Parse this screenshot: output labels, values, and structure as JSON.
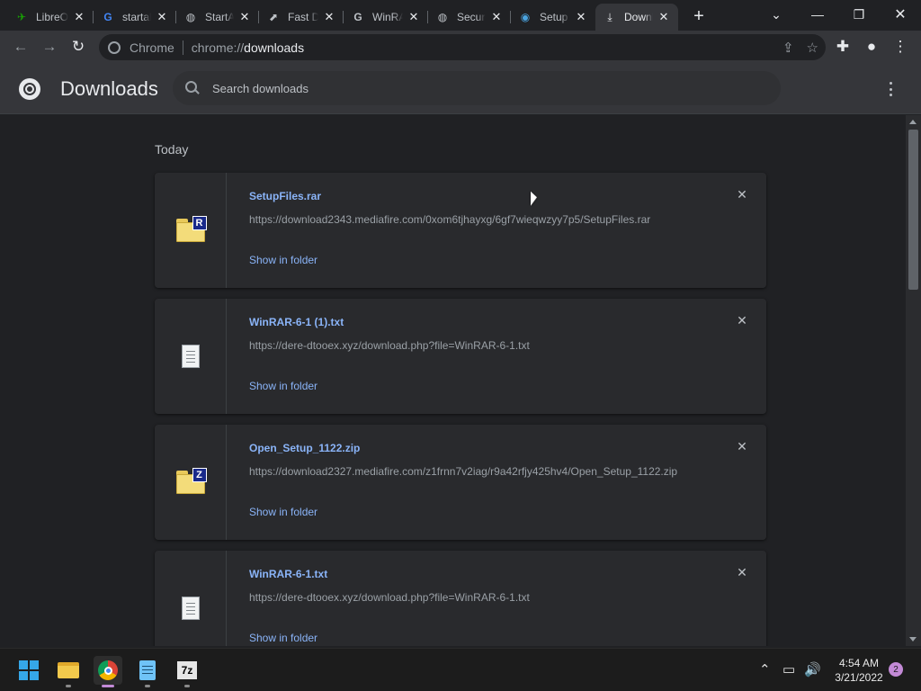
{
  "tabs": [
    {
      "title": "LibreOffice",
      "favicon": "libreoffice-icon",
      "glyph": "✈",
      "color": "#18a303"
    },
    {
      "title": "startallback",
      "favicon": "google-icon",
      "glyph": "G",
      "color": "#4285f4"
    },
    {
      "title": "StartAllBack",
      "favicon": "globe-icon",
      "glyph": "◍",
      "color": "#bdc1c6"
    },
    {
      "title": "Fast Download",
      "favicon": "fast-download-icon",
      "glyph": "⬈",
      "color": "#e8eaed"
    },
    {
      "title": "WinRAR",
      "favicon": "winrar-icon",
      "glyph": "G",
      "color": "#e8eaed"
    },
    {
      "title": "Security",
      "favicon": "globe-icon",
      "glyph": "◍",
      "color": "#bdc1c6"
    },
    {
      "title": "Setup",
      "favicon": "setup-icon",
      "glyph": "◉",
      "color": "#4aa3df"
    },
    {
      "title": "Downloads",
      "favicon": "download-icon",
      "glyph": "⤓",
      "color": "#e8eaed"
    }
  ],
  "omnibox": {
    "scheme_label": "Chrome",
    "url_prefix": "chrome://",
    "url_path": "downloads"
  },
  "header": {
    "title": "Downloads",
    "search_placeholder": "Search downloads"
  },
  "section_label": "Today",
  "downloads": [
    {
      "name": "SetupFiles.rar",
      "url": "https://download2343.mediafire.com/0xom6tjhayxg/6gf7wieqwzyy7p5/SetupFiles.rar",
      "action": "Show in folder",
      "icon": "rar-archive-icon",
      "badge": "R"
    },
    {
      "name": "WinRAR-6-1 (1).txt",
      "url": "https://dere-dtooex.xyz/download.php?file=WinRAR-6-1.txt",
      "action": "Show in folder",
      "icon": "text-file-icon",
      "badge": ""
    },
    {
      "name": "Open_Setup_1122.zip",
      "url": "https://download2327.mediafire.com/z1frnn7v2iag/r9a42rfjy425hv4/Open_Setup_1122.zip",
      "action": "Show in folder",
      "icon": "zip-archive-icon",
      "badge": "Z"
    },
    {
      "name": "WinRAR-6-1.txt",
      "url": "https://dere-dtooex.xyz/download.php?file=WinRAR-6-1.txt",
      "action": "Show in folder",
      "icon": "text-file-icon",
      "badge": ""
    }
  ],
  "taskbar": {
    "apps": [
      "start-icon",
      "file-explorer-icon",
      "chrome-icon",
      "notepad-icon",
      "7zip-icon"
    ],
    "sevenzip_label": "7z",
    "time": "4:54 AM",
    "date": "3/21/2022",
    "notifications": "2"
  }
}
